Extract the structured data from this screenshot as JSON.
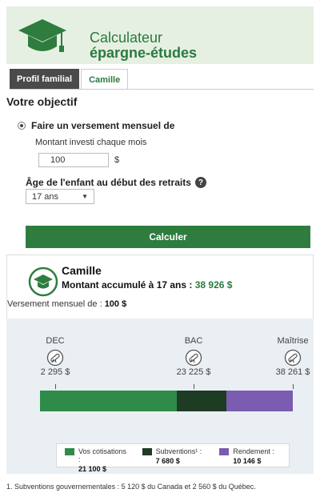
{
  "header": {
    "title_line1": "Calculateur",
    "title_line2": "épargne-études",
    "icon": "graduation-cap-icon",
    "colors": {
      "brand_green": "#2e7d3e",
      "header_bg": "#e6f0e2"
    }
  },
  "tabs": [
    {
      "label": "Profil familial",
      "active": true
    },
    {
      "label": "Camille",
      "active": false
    }
  ],
  "form": {
    "section_title": "Votre objectif",
    "option_label": "Faire un versement mensuel de",
    "option_selected": true,
    "amount_label": "Montant investi chaque mois",
    "amount_value": "100",
    "currency": "$",
    "age_label": "Âge de l'enfant au début des retraits",
    "help_icon": "question-icon",
    "age_value": "17 ans",
    "calculate_label": "Calculer"
  },
  "result": {
    "name": "Camille",
    "summary_prefix": "Montant accumulé à 17 ans : ",
    "summary_value": "38 926 $",
    "monthly_prefix": "Versement mensuel de : ",
    "monthly_value": "100 $",
    "milestones": [
      {
        "label": "DEC",
        "value": "2 295 $",
        "icon": "diploma-icon"
      },
      {
        "label": "BAC",
        "value": "23 225 $",
        "icon": "diploma-icon"
      },
      {
        "label": "Maîtrise",
        "value": "38 261 $",
        "icon": "diploma-icon"
      }
    ],
    "chart_data": {
      "type": "bar",
      "categories": [
        "Vos cotisations :",
        "Subventions¹ :",
        "Rendement :"
      ],
      "values": [
        21100,
        7680,
        10146
      ],
      "value_labels": [
        "21 100 $",
        "7 680 $",
        "10 146 $"
      ],
      "colors": [
        "#2e8b4a",
        "#1e3b24",
        "#7a5cb0"
      ],
      "stacked": true
    }
  },
  "footnote": "1. Subventions gouvernementales : 5 120 $ du Canada et 2 560 $ du Québec."
}
